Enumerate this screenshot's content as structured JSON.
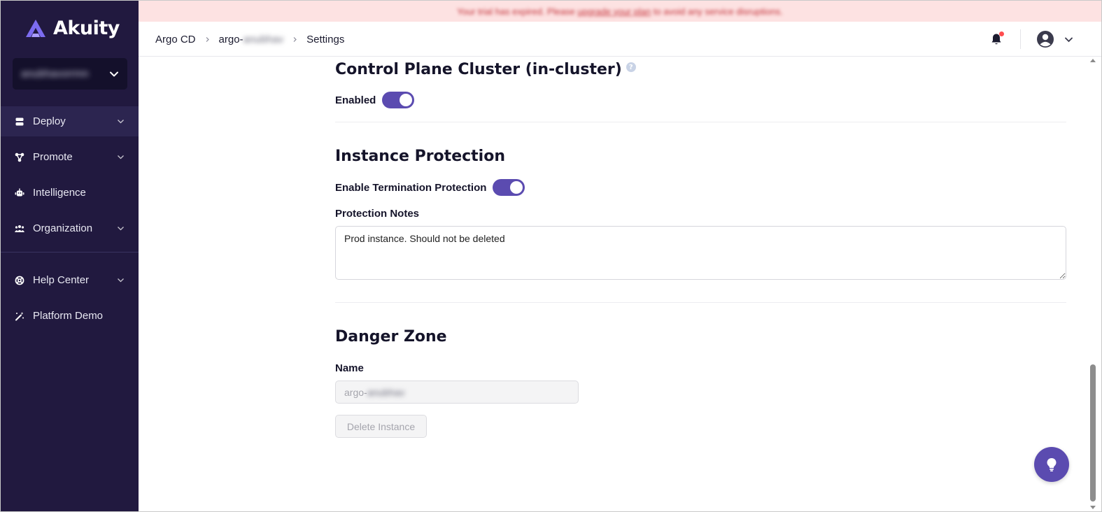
{
  "brand": {
    "name": "Akuity",
    "accent": "#5b4bb0",
    "sidebar_bg": "#21193f"
  },
  "org": {
    "name": "anubhavorrmn"
  },
  "sidebar": {
    "items": [
      {
        "label": "Deploy",
        "icon": "server-icon",
        "expandable": true,
        "active": true
      },
      {
        "label": "Promote",
        "icon": "network-icon",
        "expandable": true
      },
      {
        "label": "Intelligence",
        "icon": "robot-icon",
        "expandable": false
      },
      {
        "label": "Organization",
        "icon": "users-icon",
        "expandable": true
      }
    ],
    "secondary": [
      {
        "label": "Help Center",
        "icon": "lifebuoy-icon",
        "expandable": true
      },
      {
        "label": "Platform Demo",
        "icon": "magic-wand-icon",
        "expandable": false
      }
    ]
  },
  "banner": {
    "text_before": "Your trial has expired. Please ",
    "link": "upgrade your plan",
    "text_after": " to avoid any service disruptions."
  },
  "header": {
    "breadcrumb": {
      "root": "Argo CD",
      "instance_prefix": "argo-",
      "instance_suffix": "anubhav",
      "page": "Settings"
    }
  },
  "control_plane": {
    "title": "Control Plane Cluster (in-cluster)",
    "help": "?",
    "enabled_label": "Enabled",
    "enabled": true
  },
  "protection": {
    "title": "Instance Protection",
    "toggle_label": "Enable Termination Protection",
    "enabled": true,
    "notes_label": "Protection Notes",
    "notes_value": "Prod instance. Should not be deleted"
  },
  "danger": {
    "title": "Danger Zone",
    "name_label": "Name",
    "name_prefix": "argo-",
    "name_suffix": "anubhav",
    "delete_label": "Delete Instance"
  }
}
